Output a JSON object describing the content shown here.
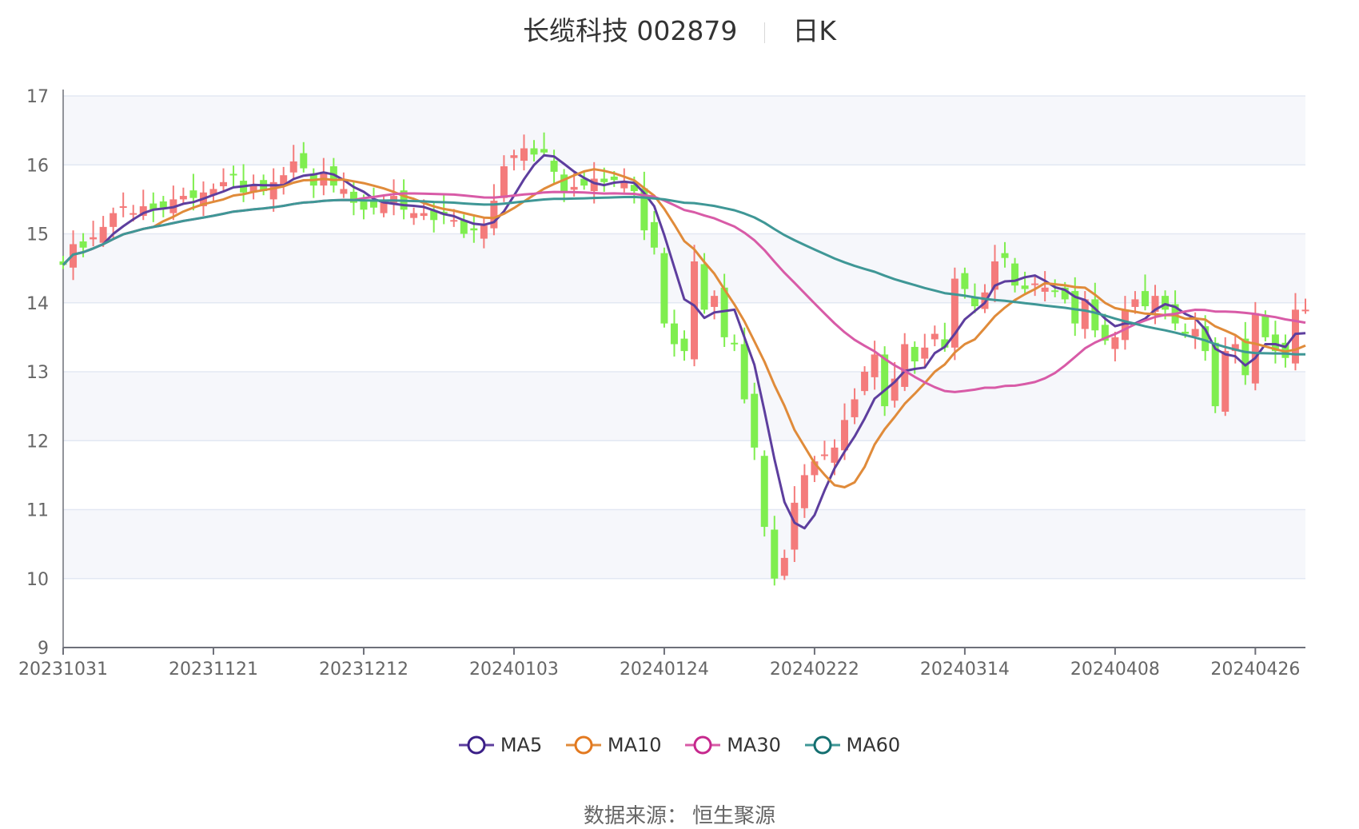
{
  "title": {
    "name": "长缆科技 002879",
    "period": "日K"
  },
  "source": {
    "label": "数据来源：",
    "value": "恒生聚源"
  },
  "chart_data": {
    "type": "candlestick",
    "ylim": [
      9,
      17
    ],
    "yticks": [
      9,
      10,
      11,
      12,
      13,
      14,
      15,
      16,
      17
    ],
    "x_ticks": [
      "20231031",
      "20231121",
      "20231212",
      "20240103",
      "20240124",
      "20240222",
      "20240314",
      "20240408",
      "20240426"
    ],
    "x_tick_index": [
      0,
      15,
      30,
      45,
      60,
      75,
      90,
      105,
      119
    ],
    "colors": {
      "up": "#f47b7b",
      "down": "#7fee4f",
      "grid": "#e3e8f3",
      "band": "#f6f7fb"
    },
    "legend": [
      {
        "name": "MA5",
        "color": "#5d3e9e"
      },
      {
        "name": "MA10",
        "color": "#e08b3a"
      },
      {
        "name": "MA30",
        "color": "#d85ba7"
      },
      {
        "name": "MA60",
        "color": "#3f9796"
      }
    ],
    "close": [
      14.55,
      14.85,
      14.8,
      14.95,
      15.1,
      15.3,
      15.4,
      15.3,
      15.4,
      15.35,
      15.38,
      15.5,
      15.55,
      15.52,
      15.6,
      15.65,
      15.75,
      15.85,
      15.6,
      15.7,
      15.62,
      15.75,
      15.85,
      16.05,
      15.95,
      15.7,
      15.9,
      15.7,
      15.65,
      15.45,
      15.35,
      15.38,
      15.45,
      15.55,
      15.35,
      15.3,
      15.3,
      15.2,
      15.28,
      15.2,
      15.0,
      15.05,
      15.12,
      15.48,
      15.98,
      16.14,
      16.24,
      16.15,
      16.18,
      15.9,
      15.6,
      15.68,
      15.7,
      15.8,
      15.75,
      15.78,
      15.75,
      15.62,
      15.05,
      14.8,
      13.7,
      13.4,
      13.3,
      14.6,
      13.9,
      14.1,
      13.5,
      13.4,
      12.6,
      11.9,
      10.75,
      10.0,
      10.3,
      11.1,
      11.5,
      11.7,
      11.8,
      11.9,
      12.3,
      12.6,
      13.0,
      13.25,
      12.5,
      12.9,
      13.4,
      13.15,
      13.35,
      13.55,
      13.35,
      14.35,
      14.2,
      13.95,
      14.15,
      14.6,
      14.65,
      14.25,
      14.2,
      14.28,
      14.22,
      14.18,
      14.05,
      13.7,
      14.05,
      13.6,
      13.45,
      13.5,
      13.9,
      14.05,
      13.95,
      14.1,
      13.9,
      13.7,
      13.55,
      13.62,
      13.3,
      12.5,
      13.3,
      13.4,
      12.95,
      13.85,
      13.5,
      13.3,
      13.2,
      13.9,
      13.9
    ]
  }
}
